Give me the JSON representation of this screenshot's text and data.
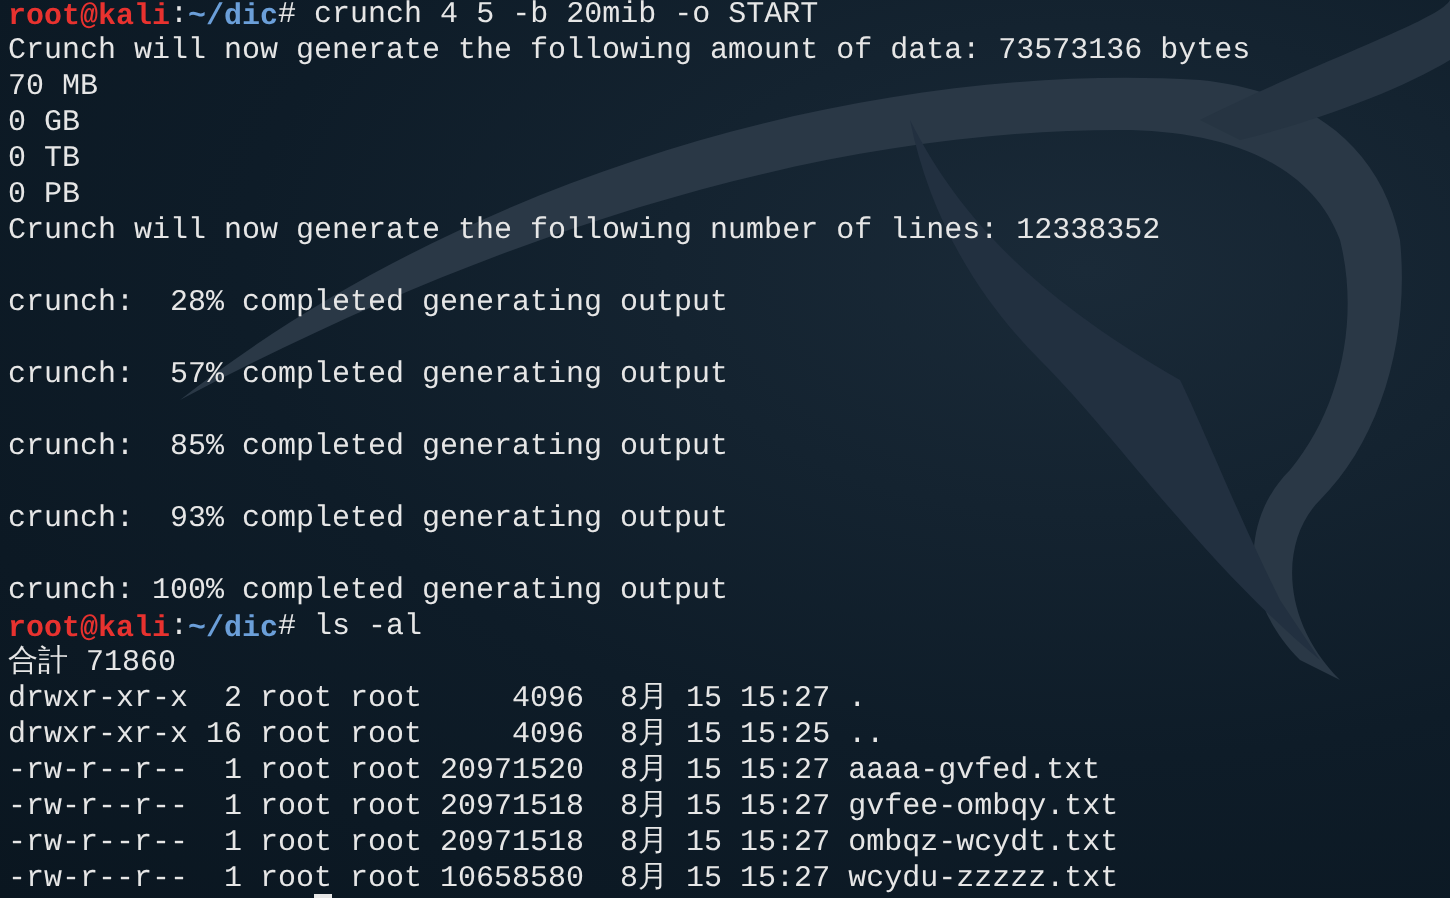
{
  "terminal": {
    "lines": [
      {
        "kind": "prompt",
        "user_host": "root@kali",
        "separator": ":",
        "path": "~/dic",
        "command": "# crunch 4 5 -b 20mib -o START"
      },
      {
        "kind": "output",
        "text": "Crunch will now generate the following amount of data: 73573136 bytes"
      },
      {
        "kind": "output",
        "text": "70 MB"
      },
      {
        "kind": "output",
        "text": "0 GB"
      },
      {
        "kind": "output",
        "text": "0 TB"
      },
      {
        "kind": "output",
        "text": "0 PB"
      },
      {
        "kind": "output",
        "text": "Crunch will now generate the following number of lines: 12338352"
      },
      {
        "kind": "blank"
      },
      {
        "kind": "output",
        "text": "crunch:  28% completed generating output"
      },
      {
        "kind": "blank"
      },
      {
        "kind": "output",
        "text": "crunch:  57% completed generating output"
      },
      {
        "kind": "blank"
      },
      {
        "kind": "output",
        "text": "crunch:  85% completed generating output"
      },
      {
        "kind": "blank"
      },
      {
        "kind": "output",
        "text": "crunch:  93% completed generating output"
      },
      {
        "kind": "blank"
      },
      {
        "kind": "output",
        "text": "crunch: 100% completed generating output"
      },
      {
        "kind": "prompt",
        "user_host": "root@kali",
        "separator": ":",
        "path": "~/dic",
        "command": "# ls -al"
      },
      {
        "kind": "output",
        "text": "合計 71860"
      },
      {
        "kind": "output",
        "text": "drwxr-xr-x  2 root root     4096  8月 15 15:27 ."
      },
      {
        "kind": "output",
        "text": "drwxr-xr-x 16 root root     4096  8月 15 15:25 .."
      },
      {
        "kind": "output",
        "text": "-rw-r--r--  1 root root 20971520  8月 15 15:27 aaaa-gvfed.txt"
      },
      {
        "kind": "output",
        "text": "-rw-r--r--  1 root root 20971518  8月 15 15:27 gvfee-ombqy.txt"
      },
      {
        "kind": "output",
        "text": "-rw-r--r--  1 root root 20971518  8月 15 15:27 ombqz-wcydt.txt"
      },
      {
        "kind": "output",
        "text": "-rw-r--r--  1 root root 10658580  8月 15 15:27 wcydu-zzzzz.txt"
      }
    ]
  }
}
